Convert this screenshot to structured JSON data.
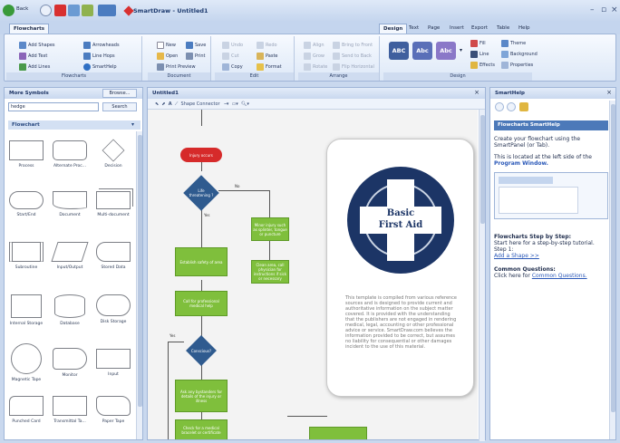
{
  "app": {
    "title": "SmartDraw - Untitled1"
  },
  "quick_access": {
    "back": "Back"
  },
  "ribbon": {
    "file_tab": "Flowcharts",
    "tabs": [
      "Design",
      "Text",
      "Page",
      "Insert",
      "Export",
      "Table",
      "Help"
    ],
    "groups": {
      "flowcharts": {
        "label": "Flowcharts",
        "items": [
          "Add Shapes",
          "Add Text",
          "Add Lines",
          "Arrowheads",
          "Line Hops",
          "SmartHelp"
        ]
      },
      "document": {
        "label": "Document",
        "items": [
          "New",
          "Open",
          "Print Preview",
          "Save",
          "Print"
        ]
      },
      "edit": {
        "label": "Edit",
        "items": [
          "Undo",
          "Cut",
          "Copy",
          "Redo",
          "Paste",
          "Format"
        ]
      },
      "arrange": {
        "label": "Arrange",
        "items": [
          "Align",
          "Grow",
          "Rotate",
          "Bring to Front",
          "Send to Back",
          "Flip Horizontal"
        ]
      },
      "design": {
        "label": "Design",
        "styles": [
          "ABC",
          "Abc",
          "Abc"
        ],
        "items": [
          "Fill",
          "Line",
          "Effects",
          "Theme",
          "Background",
          "Properties"
        ]
      }
    }
  },
  "left_pane": {
    "title": "More Symbols",
    "browse_button": "Browse...",
    "search_value": "hedge",
    "search_button": "Search",
    "library_title": "Flowchart",
    "symbols": [
      "Process",
      "Alternate Proc...",
      "Decision",
      "Start/End",
      "Document",
      "Multi-document",
      "Subroutine",
      "Input/Output",
      "Stored Data",
      "Internal Storage",
      "Database",
      "Disk Storage",
      "Magnetic Tape",
      "Monitor",
      "Input",
      "Punched Card",
      "Transmittal Ta...",
      "Paper Tape"
    ]
  },
  "canvas": {
    "tab_title": "Untitled1",
    "toolbar_text": "Shape Connector",
    "nodes": {
      "start": "Injury occurs",
      "decision1": "Life threatening ?",
      "yes": "Yes",
      "no": "No",
      "minor": "Minor injury such as splinter, tongue or puncture",
      "assess": "Establish safety of area",
      "cleanwash": "Clean area, call physician for instructions if sick or necessary",
      "call": "Call for professional medical help",
      "decision2": "Conscious?",
      "checkinj": "Ask any bystanders for details of the injury or illness",
      "medical": "Check for a medical bracelet or certificate"
    },
    "card": {
      "title_line1": "Basic",
      "title_line2": "First Aid",
      "body": "This template is compiled from various reference sources and is designed to provide current and authoritative information on the subject matter covered. It is provided with the understanding that the publishers are not engaged in rendering medical, legal, accounting or other professional advice or service. SmartDraw.com believes the information provided to be correct, but assumes no liability for consequential or other damages incident to the use of this material."
    }
  },
  "right_pane": {
    "title": "SmartHelp",
    "section_title": "Flowcharts SmartHelp",
    "p1": "Create your flowchart using the SmartPanel (or Tab).",
    "p2a": "This is located at the left side of the",
    "p2b": "Program Window.",
    "h2": "Flowcharts Step by Step:",
    "p3": "Start here for a step-by-step tutorial. Step 1:",
    "link1": "Add a Shape >>",
    "h3": "Common Questions:",
    "p4": "Click here for",
    "link2": "Common Questions."
  },
  "colors": {
    "accent": "#4c79b9",
    "flow_green": "#7fbf3c",
    "start_red": "#d62a2a",
    "decision_blue": "#2f5b8f",
    "medical_navy": "#1c3566"
  }
}
